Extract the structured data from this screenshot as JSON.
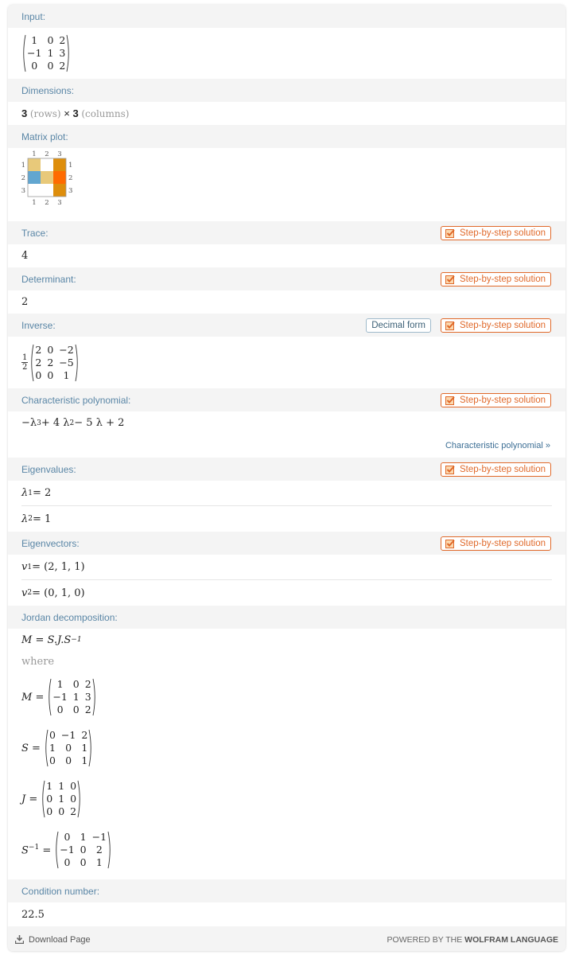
{
  "pods": {
    "input": {
      "title": "Input:",
      "matrix": [
        [
          "1",
          "0",
          "2"
        ],
        [
          "-1",
          "1",
          "3"
        ],
        [
          "0",
          "0",
          "2"
        ]
      ]
    },
    "dimensions": {
      "title": "Dimensions:",
      "rows": "3",
      "rows_label": "(rows)",
      "times": "×",
      "cols": "3",
      "cols_label": "(columns)"
    },
    "matrix_plot": {
      "title": "Matrix plot:",
      "tick_labels": [
        "1",
        "2",
        "3"
      ],
      "cells": [
        [
          "#e8c97a",
          "#ffffff",
          "#de8e0c"
        ],
        [
          "#62a6d0",
          "#e8c97a",
          "#ff6b00"
        ],
        [
          "#ffffff",
          "#ffffff",
          "#de8e0c"
        ]
      ]
    },
    "trace": {
      "title": "Trace:",
      "value": "4",
      "step_label": "Step-by-step solution"
    },
    "determinant": {
      "title": "Determinant:",
      "value": "2",
      "step_label": "Step-by-step solution"
    },
    "inverse": {
      "title": "Inverse:",
      "decimal_label": "Decimal form",
      "step_label": "Step-by-step solution",
      "scalar_num": "1",
      "scalar_den": "2",
      "matrix": [
        [
          "2",
          "0",
          "-2"
        ],
        [
          "2",
          "2",
          "-5"
        ],
        [
          "0",
          "0",
          "1"
        ]
      ]
    },
    "char_poly": {
      "title": "Characteristic polynomial:",
      "step_label": "Step-by-step solution",
      "expr": {
        "t1": "−λ",
        "e1": "3",
        "t2": " + 4 λ",
        "e2": "2",
        "t3": " − 5 λ + 2"
      },
      "more_link": "Characteristic polynomial »"
    },
    "eigenvalues": {
      "title": "Eigenvalues:",
      "step_label": "Step-by-step solution",
      "items": [
        {
          "sym": "λ",
          "sub": "1",
          "value": " = 2"
        },
        {
          "sym": "λ",
          "sub": "2",
          "value": " = 1"
        }
      ]
    },
    "eigenvectors": {
      "title": "Eigenvectors:",
      "step_label": "Step-by-step solution",
      "items": [
        {
          "sym": "v",
          "sub": "1",
          "value": " = (2, 1, 1)"
        },
        {
          "sym": "v",
          "sub": "2",
          "value": " = (0, 1, 0)"
        }
      ]
    },
    "jordan": {
      "title": "Jordan decomposition:",
      "formula": {
        "lhs": "M = S.J.S",
        "exp": "−1"
      },
      "where": "where",
      "M": {
        "label": "M =",
        "matrix": [
          [
            "1",
            "0",
            "2"
          ],
          [
            "-1",
            "1",
            "3"
          ],
          [
            "0",
            "0",
            "2"
          ]
        ]
      },
      "S": {
        "label": "S =",
        "matrix": [
          [
            "0",
            "-1",
            "2"
          ],
          [
            "1",
            "0",
            "1"
          ],
          [
            "0",
            "0",
            "1"
          ]
        ]
      },
      "J": {
        "label": "J =",
        "matrix": [
          [
            "1",
            "1",
            "0"
          ],
          [
            "0",
            "1",
            "0"
          ],
          [
            "0",
            "0",
            "2"
          ]
        ]
      },
      "Sinv": {
        "label": "S",
        "exp": "−1",
        "eq": " =",
        "matrix": [
          [
            "0",
            "1",
            "-1"
          ],
          [
            "-1",
            "0",
            "2"
          ],
          [
            "0",
            "0",
            "1"
          ]
        ]
      }
    },
    "condition": {
      "title": "Condition number:",
      "value": "22.5"
    }
  },
  "footer": {
    "download_label": "Download Page",
    "powered_prefix": "POWERED BY THE ",
    "powered_brand": "WOLFRAM LANGUAGE"
  },
  "colors": {
    "accent_orange": "#e0692a",
    "pod_title_blue": "#5a86a6",
    "link_blue": "#3d6f95"
  }
}
